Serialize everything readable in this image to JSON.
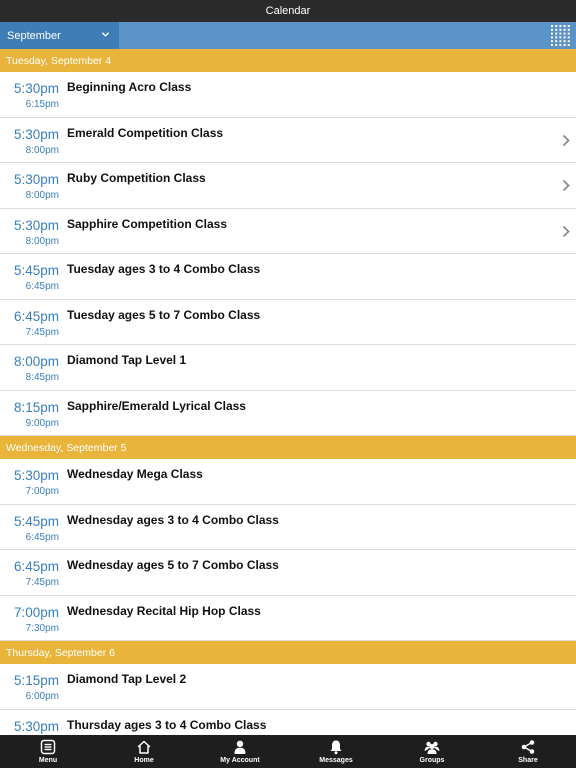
{
  "header": {
    "title": "Calendar"
  },
  "toolbar": {
    "month": "September"
  },
  "days": [
    {
      "label": "Tuesday, September 4",
      "events": [
        {
          "start": "5:30pm",
          "end": "6:15pm",
          "name": "Beginning Acro Class",
          "has_detail": false
        },
        {
          "start": "5:30pm",
          "end": "8:00pm",
          "name": "Emerald Competition Class",
          "has_detail": true
        },
        {
          "start": "5:30pm",
          "end": "8:00pm",
          "name": "Ruby Competition Class",
          "has_detail": true
        },
        {
          "start": "5:30pm",
          "end": "8:00pm",
          "name": "Sapphire Competition Class",
          "has_detail": true
        },
        {
          "start": "5:45pm",
          "end": "6:45pm",
          "name": "Tuesday ages 3 to 4 Combo Class",
          "has_detail": false
        },
        {
          "start": "6:45pm",
          "end": "7:45pm",
          "name": "Tuesday ages 5 to 7 Combo Class",
          "has_detail": false
        },
        {
          "start": "8:00pm",
          "end": "8:45pm",
          "name": "Diamond Tap Level 1",
          "has_detail": false
        },
        {
          "start": "8:15pm",
          "end": "9:00pm",
          "name": "Sapphire/Emerald Lyrical Class",
          "has_detail": false
        }
      ]
    },
    {
      "label": "Wednesday, September 5",
      "events": [
        {
          "start": "5:30pm",
          "end": "7:00pm",
          "name": "Wednesday Mega Class",
          "has_detail": false
        },
        {
          "start": "5:45pm",
          "end": "6:45pm",
          "name": "Wednesday ages 3 to 4 Combo Class",
          "has_detail": false
        },
        {
          "start": "6:45pm",
          "end": "7:45pm",
          "name": "Wednesday ages 5 to 7 Combo Class",
          "has_detail": false
        },
        {
          "start": "7:00pm",
          "end": "7:30pm",
          "name": "Wednesday Recital Hip Hop Class",
          "has_detail": false
        }
      ]
    },
    {
      "label": "Thursday, September 6",
      "events": [
        {
          "start": "5:15pm",
          "end": "6:00pm",
          "name": "Diamond Tap Level 2",
          "has_detail": false
        },
        {
          "start": "5:30pm",
          "end": "",
          "name": "Thursday ages 3 to 4 Combo Class",
          "has_detail": false
        }
      ]
    }
  ],
  "tabbar": [
    {
      "label": "Menu",
      "icon": "menu-icon"
    },
    {
      "label": "Home",
      "icon": "home-icon"
    },
    {
      "label": "My Account",
      "icon": "user-icon"
    },
    {
      "label": "Messages",
      "icon": "bell-icon"
    },
    {
      "label": "Groups",
      "icon": "groups-icon"
    },
    {
      "label": "Share",
      "icon": "share-icon"
    }
  ],
  "colors": {
    "title_bar": "#2b2b2b",
    "toolbar": "#5b93c6",
    "month_select": "#3f7db7",
    "day_header": "#e8b43a",
    "time_text": "#3a7fbf",
    "tab_bar": "#1e1e1e"
  }
}
